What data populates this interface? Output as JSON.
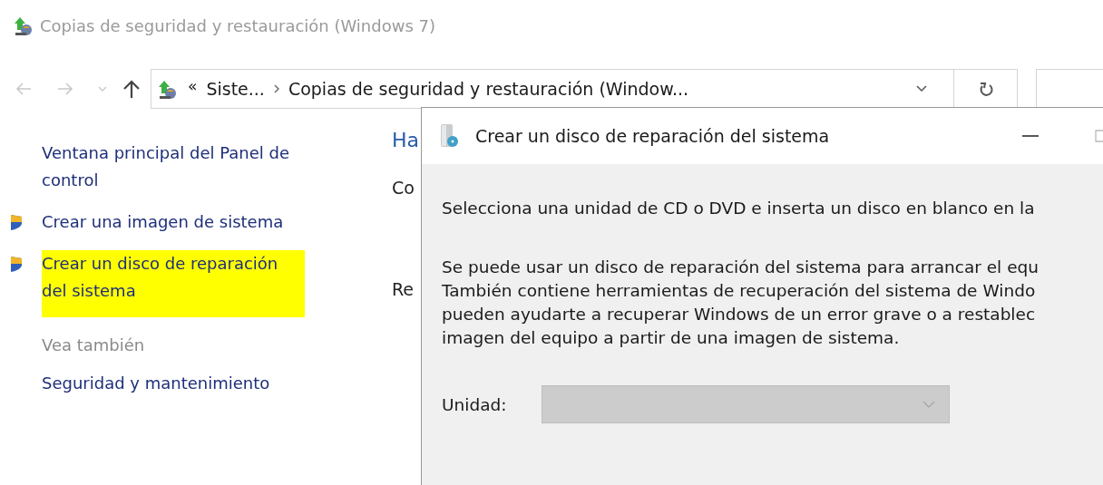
{
  "window": {
    "title": "Copias de seguridad y restauración (Windows 7)"
  },
  "nav_buttons": [
    {
      "kind": "back",
      "disabled": true
    },
    {
      "kind": "forward",
      "disabled": true
    },
    {
      "kind": "recent",
      "disabled": true
    },
    {
      "kind": "up",
      "disabled": false
    }
  ],
  "address_bar": {
    "overflow": "«",
    "segments": [
      "Siste...",
      "Copias de seguridad y restauración (Window..."
    ]
  },
  "sidebar": {
    "items": [
      {
        "label": "Ventana principal del Panel de control",
        "kind": "link",
        "highlighted": false
      },
      {
        "label": "Crear una imagen de sistema",
        "kind": "shield-link",
        "highlighted": false
      },
      {
        "label": "Crear un disco de reparación del sistema",
        "kind": "shield-link",
        "highlighted": true
      },
      {
        "label": "Vea también",
        "kind": "heading",
        "highlighted": false
      },
      {
        "label": "Seguridad y mantenimiento",
        "kind": "link",
        "highlighted": false
      }
    ]
  },
  "main": {
    "heading": "Ha",
    "lines": [
      "Co",
      "Re"
    ]
  },
  "dialog": {
    "title": "Crear un disco de reparación del sistema",
    "instruction": "Selecciona una unidad de CD o DVD e inserta un disco en blanco en la",
    "description_lines": [
      "Se puede usar un disco de reparación del sistema para arrancar el equ",
      "También contiene herramientas de recuperación del sistema de Windo",
      "pueden ayudarte a recuperar Windows de un error grave o a restablec",
      "imagen del equipo a partir de una imagen de sistema."
    ],
    "drive": {
      "label": "Unidad:",
      "disabled": true
    }
  }
}
